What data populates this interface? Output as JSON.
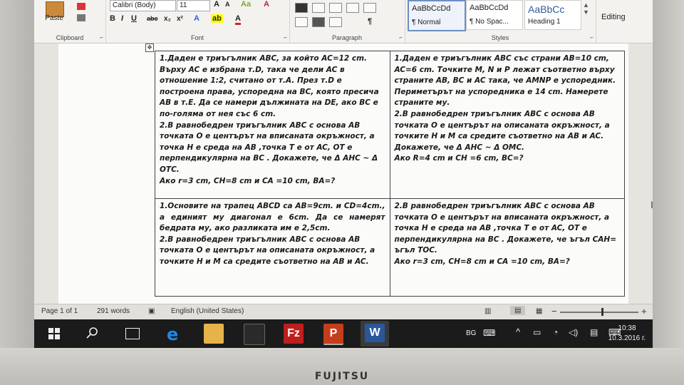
{
  "ribbon": {
    "clipboard": {
      "paste_label": "Paste",
      "group_label": "Clipboard"
    },
    "font": {
      "font_name": "Calibri (Body)",
      "font_size": "11",
      "group_label": "Font"
    },
    "paragraph": {
      "group_label": "Paragraph"
    },
    "styles": {
      "group_label": "Styles",
      "cards": [
        {
          "sample": "AaBbCcDd",
          "name": "¶ Normal"
        },
        {
          "sample": "AaBbCcDd",
          "name": "¶ No Spac..."
        },
        {
          "sample": "AaBbCc",
          "name": "Heading 1"
        }
      ]
    },
    "editing_label": "Editing"
  },
  "document": {
    "cells": [
      [
        "1.Даден е триъгълник ABC, за който AC=12 cm. Върху AC е избрана т.D, така че дели AC в отношение 1:2, считано от т.A. През т.D е построена права, успоредна на BC, която пресича AB в т.E. Да се намери дължината на DE, ако BC е   по-голяма от нея със 6 cm.",
        "2.В равнобедрен триъгълник ABC с основа AB точката O е центърът на вписаната окръжност,  а точка H е среда на AB ,точка T е от AC, OT е перпендикулярна на BC . Докажете, че  Δ AHC ~ Δ OTC.",
        "Ако r=3 cm, CH=8 cm и CA =10 cm,  BA=?"
      ],
      [
        "1.Даден е триъгълник ABC със страни AB=10 cm, AC=6 cm. Точките M, N и P лежат съответно върху страните AB, BC и AC така, че AMNP е успоредник. Периметърът на успоредника е 14 cm. Намерете страните му.",
        "2.В равнобедрен триъгълник ABC с основа AB точката O е центърът на описаната окръжност,  а точките H и M са средите съответно на AB и AC.",
        "Докажете, че  Δ AHC ~ Δ OMC.",
        "Ако R=4 cm и CH =6 cm,  BC=?"
      ],
      [
        "1.Основите на трапец ABCD са AB=9cm. и CD=4cm., а   единият му диагонал е 6cm. Да   се   намерят   бедрата   му,   ако разликата им е  2,5cm.",
        "2.В равнобедрен триъгълник ABC с основа AB точката O е центърът на описаната окръжност,  а точките H и M са средите съответно на AB и AC."
      ],
      [
        "2.В равнобедрен триъгълник ABC с основа AB точката O е центърът на вписаната окръжност,  а точка H е среда на AB ,точка T е от AC, OT е перпендикулярна на BC . Докажете, че  ъгъл CAH= ъгъл TOC.",
        "Ако r=3 cm, CH=8 cm и CA =10 cm,  BA=?"
      ]
    ]
  },
  "status": {
    "page": "Page 1 of 1",
    "words": "291 words",
    "language": "English (United States)",
    "zoom": "100 %"
  },
  "taskbar": {
    "lang": "BG",
    "time": "10:38",
    "date": "10.3.2016 г."
  },
  "brand": "FUJITSU",
  "colors": {
    "accent_word": "#2b579a",
    "accent_ppt": "#c43e1c",
    "accent_filezilla": "#bf1e1e",
    "edge": "#1e88e5"
  }
}
